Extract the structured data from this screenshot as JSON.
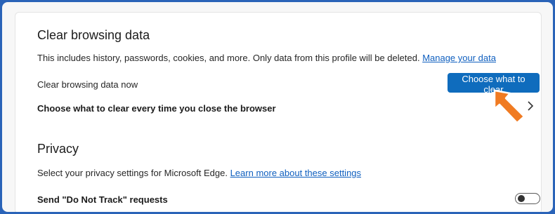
{
  "clear_section": {
    "heading": "Clear browsing data",
    "description": "This includes history, passwords, cookies, and more. Only data from this profile will be deleted.",
    "manage_link": "Manage your data",
    "now_label": "Clear browsing data now",
    "choose_button": "Choose what to clear",
    "every_time_label": "Choose what to clear every time you close the browser"
  },
  "privacy_section": {
    "heading": "Privacy",
    "description": "Select your privacy settings for Microsoft Edge.",
    "learn_link": "Learn more about these settings",
    "dnt_label": "Send \"Do Not Track\" requests",
    "dnt_enabled": false
  },
  "colors": {
    "accent": "#0f6cbd",
    "frame": "#2a63b8",
    "annotation_arrow": "#f07b22"
  },
  "icons": [
    "chevron-right-icon",
    "toggle-switch",
    "arrow-annotation"
  ]
}
